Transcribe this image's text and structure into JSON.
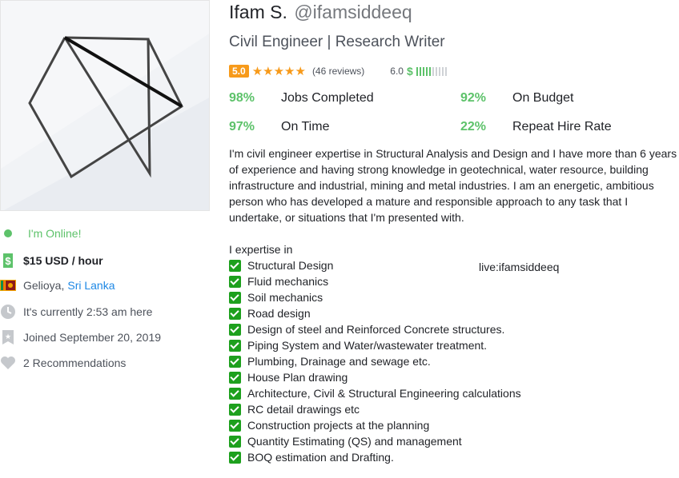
{
  "profile": {
    "name": "Ifam S.",
    "username": "@ifamsiddeeq",
    "tagline": "Civil Engineer | Research Writer",
    "rating": "5.0",
    "stars": "★★★★★",
    "reviews": "(46 reviews)",
    "earnings_score": "6.0",
    "earnings_symbol": "$",
    "earnings_level": 0.5
  },
  "stats": [
    {
      "percent": "98%",
      "label": "Jobs Completed"
    },
    {
      "percent": "92%",
      "label": "On Budget"
    },
    {
      "percent": "97%",
      "label": "On Time"
    },
    {
      "percent": "22%",
      "label": "Repeat Hire Rate"
    }
  ],
  "sidebar": {
    "status": "I'm Online!",
    "rate": "$15 USD / hour",
    "city": "Gelioya,",
    "country": "Sri Lanka",
    "local_time": "It's currently 2:53 am here",
    "joined": "Joined September 20, 2019",
    "recommendations": "2 Recommendations"
  },
  "description": "I'm civil engineer expertise in Structural Analysis and Design and I have more than 6 years of experience and having strong knowledge in geotechnical, water resource, building infrastructure and industrial, mining and metal industries. I am an energetic, ambitious person who has developed a mature and responsible approach to any task that I undertake, or situations that I'm presented with.",
  "expertise_heading": "I expertise in",
  "skills": [
    "Structural Design",
    "Fluid mechanics",
    "Soil mechanics",
    "Road design",
    "Design of steel and Reinforced Concrete structures.",
    "Piping System and Water/wastewater treatment.",
    "Plumbing, Drainage and sewage etc.",
    "House Plan drawing",
    "Architecture, Civil & Structural Engineering calculations",
    "RC detail drawings etc",
    "Construction projects at the planning",
    "Quantity Estimating (QS) and management",
    "BOQ estimation and Drafting."
  ],
  "contact_note": "live:ifamsiddeeq",
  "colors": {
    "accent_green": "#5dc26a",
    "rating_orange": "#f79a1a",
    "link_blue": "#1e88e5",
    "check_green": "#1da01d"
  }
}
